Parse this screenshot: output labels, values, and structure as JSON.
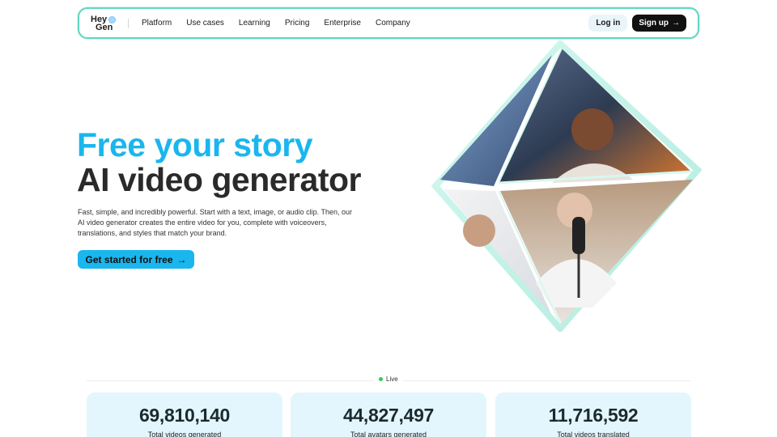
{
  "nav": {
    "logo": {
      "line1": "Hey",
      "line2": "Gen"
    },
    "menu": [
      "Platform",
      "Use cases",
      "Learning",
      "Pricing",
      "Enterprise",
      "Company"
    ],
    "login": "Log in",
    "signup": "Sign up",
    "signup_icon": "arrow-right-icon"
  },
  "hero": {
    "headline_1": "Free your story",
    "headline_2": "AI video generator",
    "description": "Fast, simple, and incredibly powerful. Start with a text, image, or audio clip. Then, our AI video generator creates the entire video for you, complete with voiceovers, translations, and styles that match your brand.",
    "cta": "Get started for free",
    "cta_icon": "arrow-right-icon"
  },
  "stats": {
    "live_label": "Live",
    "items": [
      {
        "value": "69,810,140",
        "label": "Total videos generated"
      },
      {
        "value": "44,827,497",
        "label": "Total avatars generated"
      },
      {
        "value": "11,716,592",
        "label": "Total videos translated"
      }
    ]
  },
  "colors": {
    "accent": "#1ab6ee",
    "nav_border": "#5fd7c1",
    "card_bg": "#e3f6fe",
    "live_dot": "#2ecc5a"
  }
}
